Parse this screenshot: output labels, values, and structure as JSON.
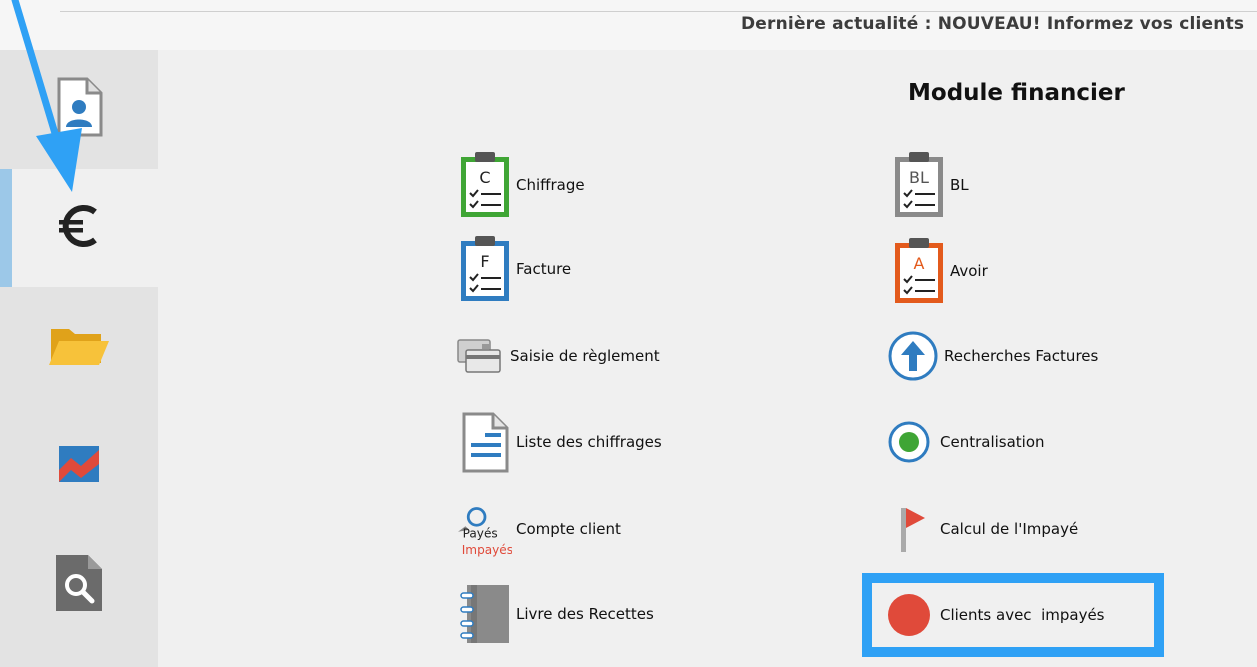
{
  "header": {
    "news": "Dernière actualité : NOUVEAU! Informez vos clients"
  },
  "sidebar": {
    "items": [
      {
        "icon": "user-document-icon"
      },
      {
        "icon": "euro-icon",
        "active": true
      },
      {
        "icon": "folder-icon"
      },
      {
        "icon": "chart-icon"
      },
      {
        "icon": "search-document-icon"
      }
    ]
  },
  "main": {
    "title": "Module financier",
    "left": [
      {
        "label": "Chiffrage",
        "icon": "clipboard-c-icon",
        "letter": "C"
      },
      {
        "label": "Facture",
        "icon": "clipboard-f-icon",
        "letter": "F"
      },
      {
        "label": "Saisie de règlement",
        "icon": "credit-card-icon"
      },
      {
        "label": "Liste des chiffrages",
        "icon": "document-list-icon"
      },
      {
        "label": "Compte client",
        "icon": "payes-impayes-icon",
        "tag1": "Payés",
        "tag2": "Impayés"
      },
      {
        "label": "Livre des Recettes",
        "icon": "notebook-icon"
      }
    ],
    "right": [
      {
        "label": "BL",
        "icon": "clipboard-bl-icon",
        "letter": "BL"
      },
      {
        "label": "Avoir",
        "icon": "clipboard-a-icon",
        "letter": "A"
      },
      {
        "label": "Recherches Factures",
        "icon": "arrow-up-circle-icon"
      },
      {
        "label": "Centralisation",
        "icon": "radio-dot-icon"
      },
      {
        "label": "Calcul de l'Impayé",
        "icon": "flag-icon"
      },
      {
        "label": "Clients avec  impayés",
        "icon": "red-circle-icon"
      }
    ]
  },
  "colors": {
    "accent": "#2fa1f5",
    "green": "#3fa535",
    "blue": "#2f7cc0",
    "gray": "#8a8a8a",
    "orange": "#e35a1c",
    "red": "#e04a3a"
  }
}
